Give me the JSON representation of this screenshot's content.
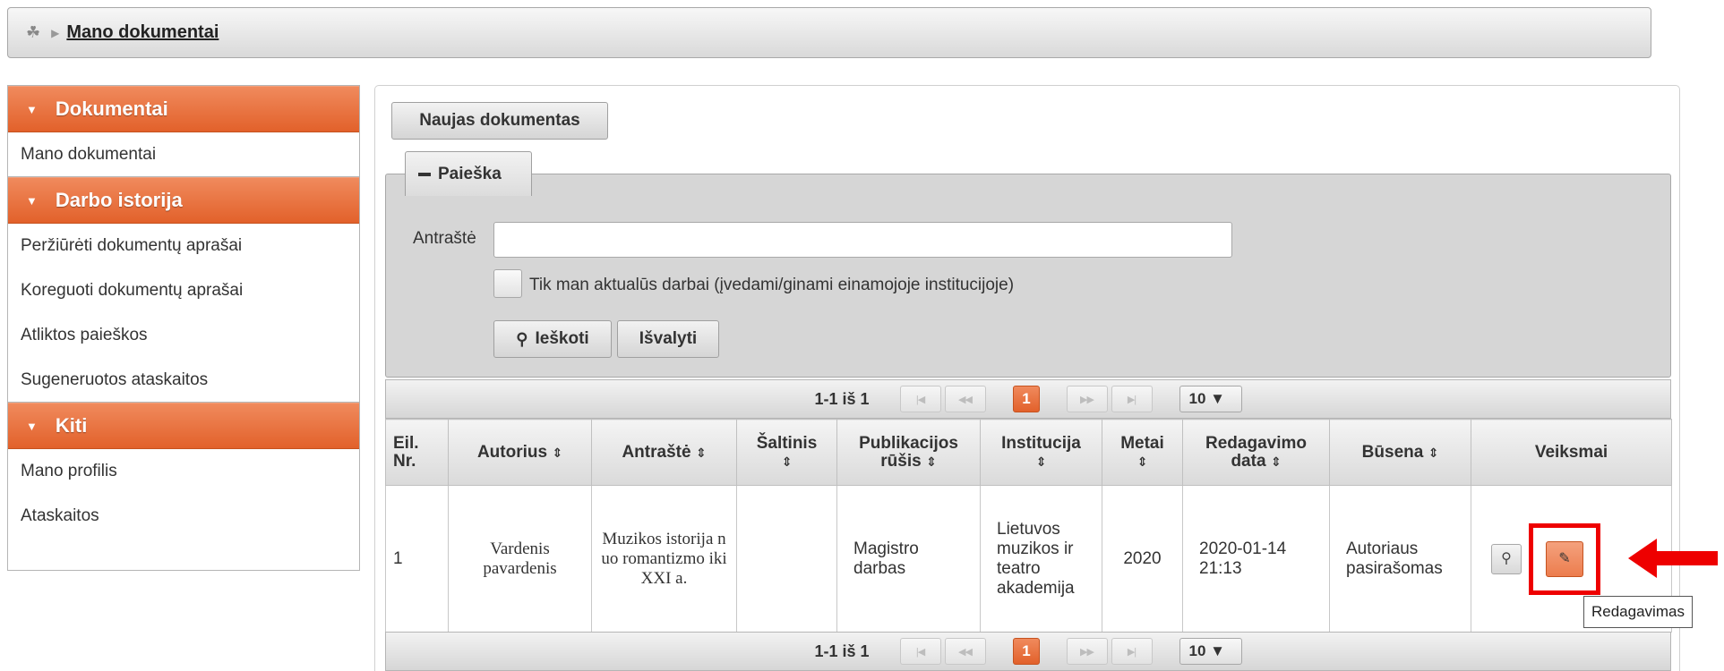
{
  "breadcrumb": {
    "home_icon": "home-icon",
    "current": "Mano dokumentai"
  },
  "sidebar": {
    "groups": [
      {
        "title": "Dokumentai",
        "items": [
          "Mano dokumentai"
        ]
      },
      {
        "title": "Darbo istorija",
        "items": [
          "Peržiūrėti dokumentų aprašai",
          "Koreguoti dokumentų aprašai",
          "Atliktos paieškos",
          "Sugeneruotos ataskaitos"
        ]
      },
      {
        "title": "Kiti",
        "items": [
          "Mano profilis",
          "Ataskaitos"
        ]
      }
    ]
  },
  "main": {
    "new_document_label": "Naujas dokumentas",
    "search": {
      "legend": "Paieška",
      "title_label": "Antraštė",
      "title_value": "",
      "checkbox_label": "Tik man aktualūs darbai (įvedami/ginami einamojoje institucijoje)",
      "checkbox_checked": false,
      "search_button": "Ieškoti",
      "clear_button": "Išvalyti"
    },
    "pager": {
      "info": "1-1 iš 1",
      "current_page": "1",
      "page_size": "10 ▼"
    },
    "table": {
      "headers": {
        "nr": "Eil. Nr.",
        "author": "Autorius",
        "title": "Antraštė",
        "source": "Šaltinis",
        "pub_type": "Publikacijos rūšis",
        "institution": "Institucija",
        "year": "Metai",
        "edit_date": "Redagavimo data",
        "status": "Būsena",
        "actions": "Veiksmai"
      },
      "rows": [
        {
          "nr": "1",
          "author": "Vardenis pavardenis",
          "title": "Muzikos istorija nuo romantizmo iki XXI a.",
          "source": "",
          "pub_type": "Magistro darbas",
          "institution": "Lietuvos muzikos ir teatro akademija",
          "year": "2020",
          "edit_date": "2020-01-14 21:13",
          "status": "Autoriaus pasirašomas"
        }
      ]
    },
    "tooltip": "Redagavimas"
  },
  "colors": {
    "accent": "#e8703d",
    "highlight": "#ee0000"
  }
}
